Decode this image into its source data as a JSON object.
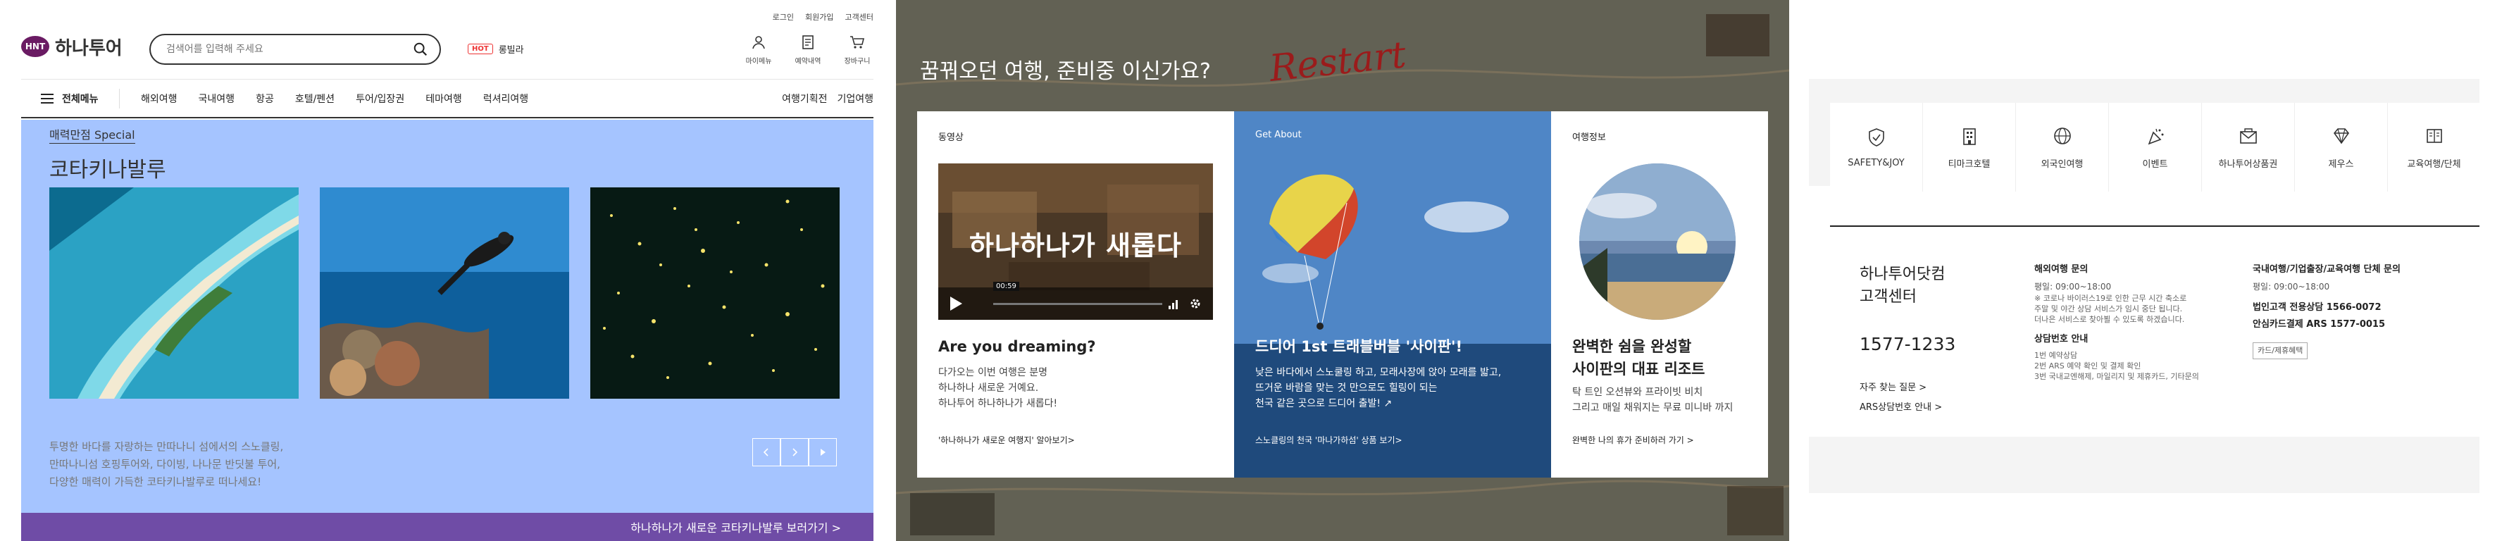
{
  "site": {
    "logo_badge": "HNT",
    "logo_text": "하나투어",
    "search_placeholder": "검색어를 입력해 주세요",
    "hot_badge": "HOT",
    "hot_label": "롱빌라",
    "util_links": [
      "로그인",
      "회원가입",
      "고객센터"
    ],
    "quick_icons": [
      "마이메뉴",
      "예약내역",
      "장바구니"
    ],
    "all_menu_label": "전체메뉴",
    "gnb_items": [
      "해외여행",
      "국내여행",
      "항공",
      "호텔/펜션",
      "투어/입장권",
      "테마여행",
      "럭셔리여행"
    ],
    "gnb_right": [
      "여행기획전",
      "기업여행"
    ]
  },
  "promo": {
    "tag": "매력만점 Special",
    "title": "코타키나발루",
    "desc": [
      "투명한 바다를 자랑하는 만따나니 섬에서의 스노클링,",
      "만따나니섬 호핑투어와, 다이빙, 나나문 반딧불 투어,",
      "다양한 매력이 가득한 코타키나발루로 떠나세요!"
    ],
    "bar_text": "하나하나가 새로운 코타키나발루 보러가기 >",
    "bg_color": "#a5c4ff",
    "bar_color": "#6f4ca6"
  },
  "feature": {
    "heading": "꿈꿔오던 여행, 준비중 이신가요?",
    "restart_text": "Restart",
    "cards": [
      {
        "label": "동영상",
        "video_text": "하나하나가 새롭다",
        "video_time": "00:59",
        "title": [
          "Are you dreaming?"
        ],
        "desc": [
          "다가오는 이번 여행은 분명",
          "하나하나 새로운 거예요.",
          "하나투어 하나하나가 새롭다!"
        ],
        "link": "'하나하나가 새로운 여행지' 알아보기>"
      },
      {
        "label": "Get About",
        "title": [
          "드디어 1st 트래블버블 '사이판'!"
        ],
        "desc": [
          "낮은 바다에서 스노쿨링 하고, 모래사장에 앉아 모래를 밟고,",
          "뜨거운 바람을 맞는 것 만으로도 힐링이 되는",
          "천국 같은 곳으로 드디어 출발! ↗"
        ],
        "link": "스노클링의 천국 '마나가하섬' 상품 보기>"
      },
      {
        "label": "여행정보",
        "title": [
          "완벽한 쉼을 완성할",
          "사이판의 대표 리조트"
        ],
        "desc": [
          "탁 트인 오션뷰와 프라이빗 비치",
          "그리고 매일 채워지는 무료 미니바 까지"
        ],
        "link": "완벽한 나의 휴가 준비하러 가기 >"
      }
    ]
  },
  "services": [
    {
      "label": "SAFETY&JOY",
      "icon": "shield-check-icon"
    },
    {
      "label": "티마크호텔",
      "icon": "hotel-icon"
    },
    {
      "label": "외국인여행",
      "icon": "globe-icon"
    },
    {
      "label": "이벤트",
      "icon": "party-icon"
    },
    {
      "label": "하나투어상품권",
      "icon": "envelope-icon"
    },
    {
      "label": "제우스",
      "icon": "diamond-icon"
    },
    {
      "label": "교육여행/단체",
      "icon": "book-icon"
    }
  ],
  "customer_center": {
    "title": [
      "하나투어닷컴",
      "고객센터"
    ],
    "phone": "1577-1233",
    "links": [
      "자주 찾는 질문 >",
      "ARS상담번호 안내 >"
    ],
    "overseas": {
      "heading": "해외여행 문의",
      "hours": "평일: 09:00~18:00",
      "notice": [
        "※ 코로나 바이러스19로 인한 근무 시간 축소로",
        "주말 및 야간 상담 서비스가 임시 중단 됩니다.",
        "더나은 서비스로 찾아뵐 수 있도록 하겠습니다."
      ],
      "sub_heading": "상담번호 안내",
      "lines": [
        "1번 예약상담",
        "2번 ARS 예약 확인 및 결제 확인",
        "3번 국내교엔해제, 마일리지 및 제휴카드, 기타문의"
      ]
    },
    "domestic": {
      "heading": "국내여행/기업출장/교육여행 단체 문의",
      "hours": "평일: 09:00~18:00",
      "lines": [
        "법인고객 전용상담 1566-0072",
        "안심카드결제 ARS 1577-0015"
      ],
      "button": "카드/제휴혜택"
    }
  }
}
